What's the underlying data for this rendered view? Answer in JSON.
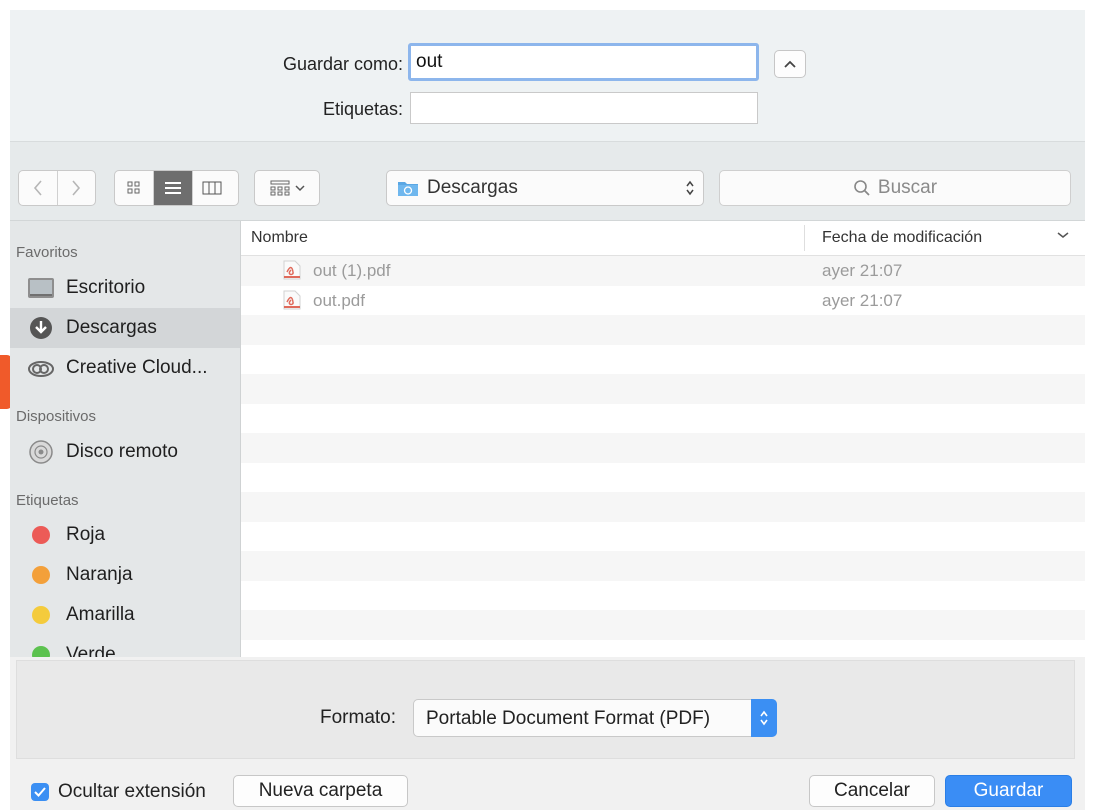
{
  "save": {
    "save_as_label": "Guardar como:",
    "save_as_value": "out",
    "tags_label": "Etiquetas:",
    "tags_value": "",
    "expand_icon": "chevron-up-icon"
  },
  "toolbar": {
    "back_icon": "chevron-left-icon",
    "forward_icon": "chevron-right-icon",
    "view_modes": [
      "icon-view",
      "list-view",
      "column-view"
    ],
    "active_view": "list-view",
    "arrange_icon": "group-by-icon",
    "location": "Descargas",
    "search_placeholder": "Buscar"
  },
  "sidebar": {
    "favorites_heading": "Favoritos",
    "favorites": [
      {
        "label": "Escritorio",
        "icon": "desktop-icon"
      },
      {
        "label": "Descargas",
        "icon": "downloads-icon",
        "selected": true
      },
      {
        "label": "Creative Cloud...",
        "icon": "creative-cloud-icon"
      }
    ],
    "devices_heading": "Dispositivos",
    "devices": [
      {
        "label": "Disco remoto",
        "icon": "remote-disc-icon"
      }
    ],
    "tags_heading": "Etiquetas",
    "tags": [
      {
        "label": "Roja",
        "color": "#ec5b57"
      },
      {
        "label": "Naranja",
        "color": "#f3a03a"
      },
      {
        "label": "Amarilla",
        "color": "#f4cb3c"
      },
      {
        "label": "Verde",
        "color": "#5cc24f"
      }
    ]
  },
  "file_list": {
    "col_name": "Nombre",
    "col_date": "Fecha de modificación",
    "files": [
      {
        "name": "out (1).pdf",
        "date": "ayer 21:07",
        "icon": "pdf-file-icon"
      },
      {
        "name": "out.pdf",
        "date": "ayer 21:07",
        "icon": "pdf-file-icon"
      }
    ]
  },
  "format": {
    "label": "Formato:",
    "value": "Portable Document Format (PDF)"
  },
  "bottom": {
    "hide_extension_label": "Ocultar extensión",
    "hide_extension_checked": true,
    "new_folder_label": "Nueva carpeta",
    "cancel_label": "Cancelar",
    "save_label": "Guardar"
  },
  "colors": {
    "accent": "#3a8df5",
    "side_tab": "#f05a2a"
  }
}
